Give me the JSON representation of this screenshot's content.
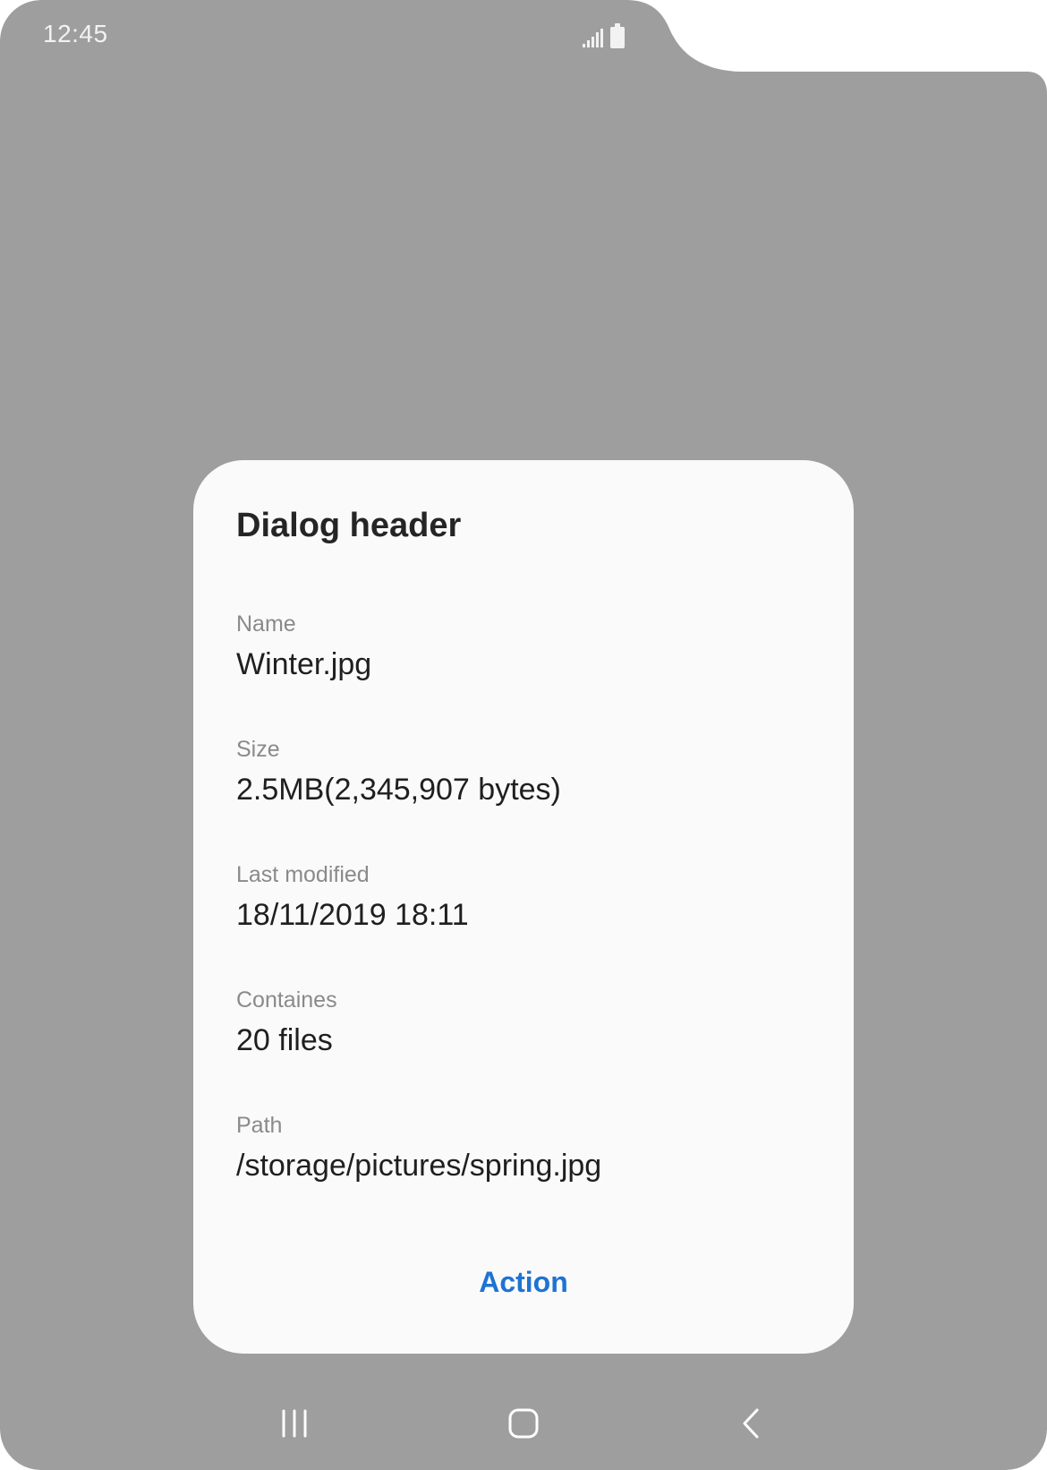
{
  "status_bar": {
    "time": "12:45",
    "signal_icon": "signal-icon",
    "battery_icon": "battery-icon"
  },
  "dialog": {
    "header": "Dialog header",
    "fields": [
      {
        "label": "Name",
        "value": "Winter.jpg"
      },
      {
        "label": "Size",
        "value": "2.5MB(2,345,907 bytes)"
      },
      {
        "label": "Last modified",
        "value": "18/11/2019 18:11"
      },
      {
        "label": "Containes",
        "value": "20 files"
      },
      {
        "label": "Path",
        "value": "/storage/pictures/spring.jpg"
      }
    ],
    "action_label": "Action"
  },
  "nav_bar": {
    "recents_icon": "recents-icon",
    "home_icon": "home-icon",
    "back_icon": "back-icon"
  },
  "colors": {
    "scrim": "#9e9e9e",
    "dialog_bg": "#fafafa",
    "accent": "#1e73d2"
  }
}
